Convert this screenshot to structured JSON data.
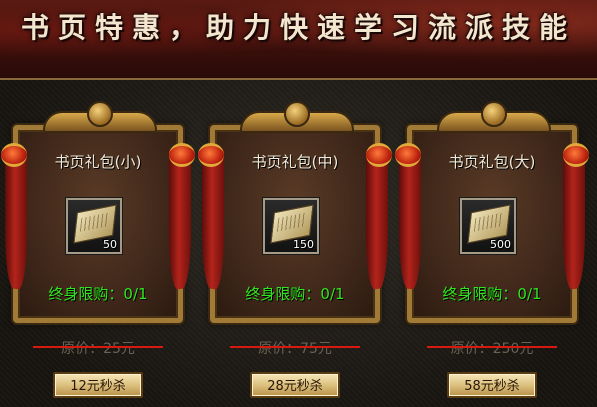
{
  "banner": {
    "title": "书页特惠，助力快速学习流派技能"
  },
  "accent_colors": {
    "limit_text": "#2ee61e",
    "strike_line": "#d61a10",
    "banner_bg": "#4a140e"
  },
  "cards": [
    {
      "title": "书页礼包(小)",
      "item_icon": "book-page-icon",
      "item_count": "50",
      "limit": "终身限购：0/1",
      "original_price": "原价：25元",
      "buy_label": "12元秒杀"
    },
    {
      "title": "书页礼包(中)",
      "item_icon": "book-page-icon",
      "item_count": "150",
      "limit": "终身限购：0/1",
      "original_price": "原价：75元",
      "buy_label": "28元秒杀"
    },
    {
      "title": "书页礼包(大)",
      "item_icon": "book-page-icon",
      "item_count": "500",
      "limit": "终身限购：0/1",
      "original_price": "原价：250元",
      "buy_label": "58元秒杀"
    }
  ]
}
